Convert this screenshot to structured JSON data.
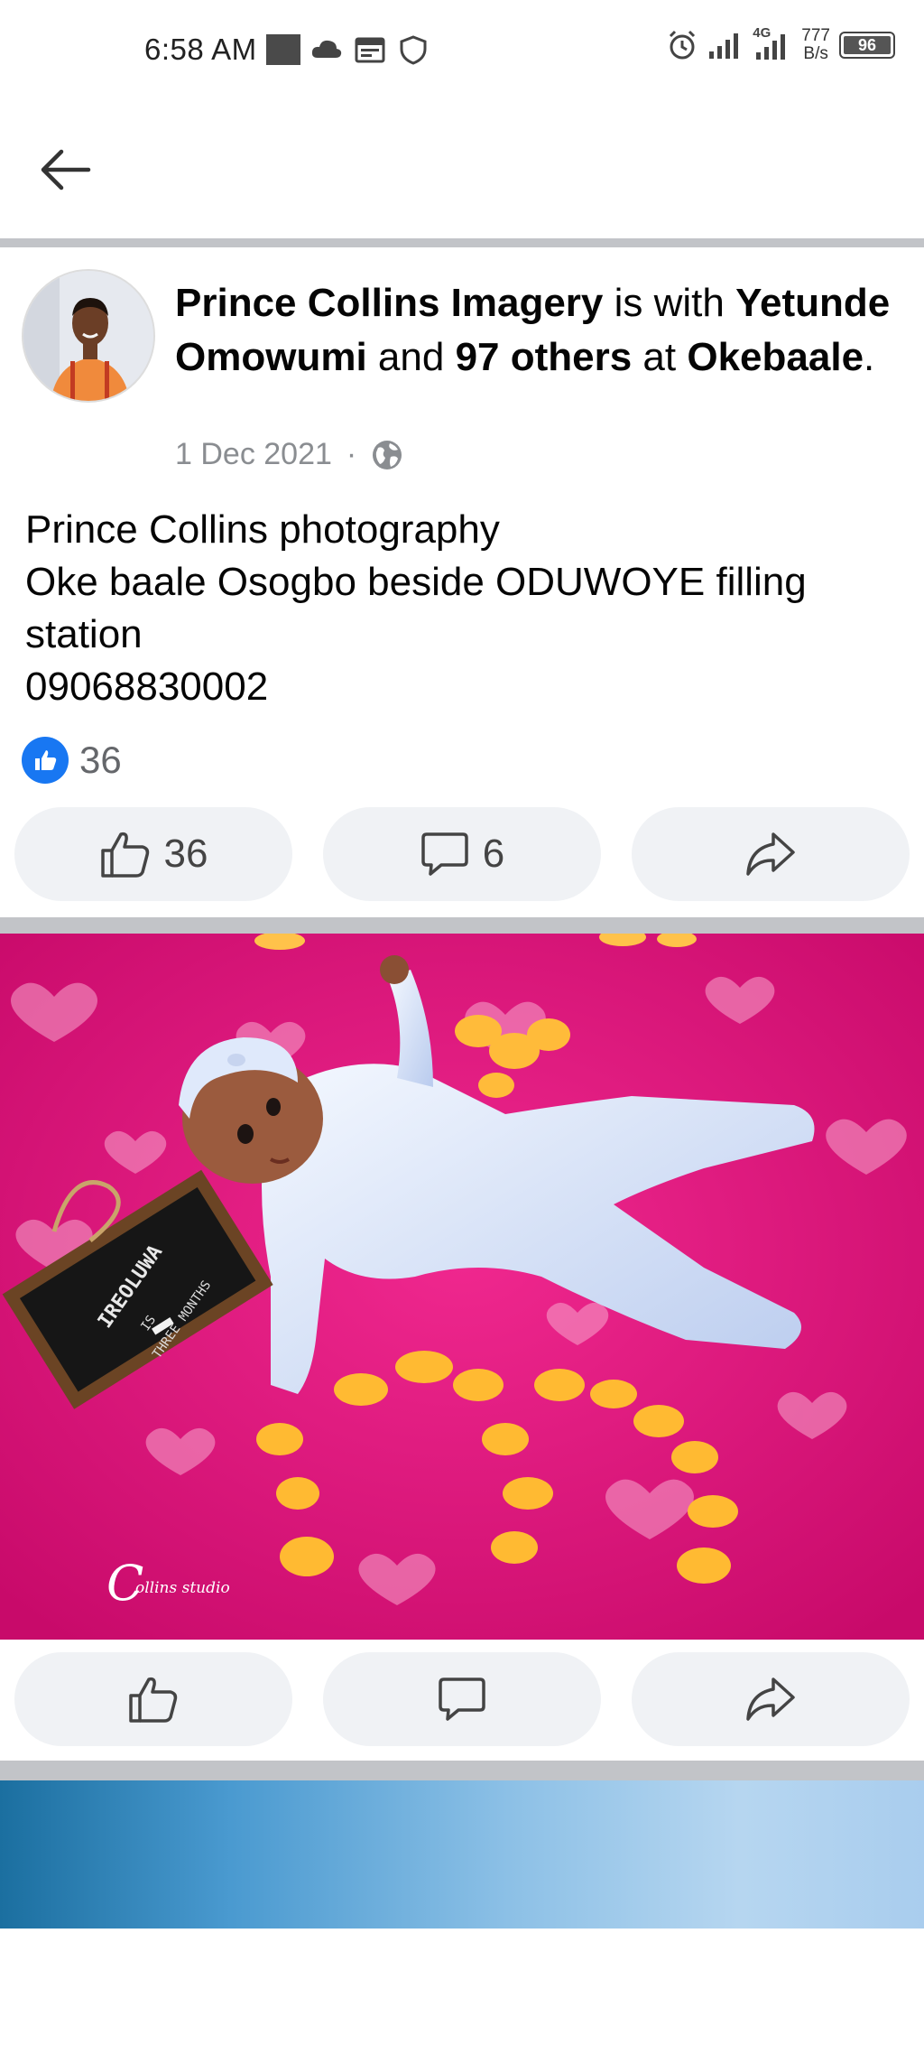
{
  "status_bar": {
    "time": "6:58 AM",
    "network": "4G",
    "speed_value": "777",
    "speed_unit": "B/s",
    "battery": "96"
  },
  "post": {
    "author": "Prince Collins Imagery",
    "is_with": " is with ",
    "tagged_person": "Yetunde Omowumi",
    "and": " and ",
    "others": "97 others",
    "at": " at ",
    "location": "Okebaale",
    "period": ".",
    "date": "1 Dec 2021",
    "separator": "·",
    "privacy_icon": "globe-icon",
    "text_lines": [
      "Prince Collins photography",
      "Oke baale Osogbo beside ODUWOYE filling",
      "station",
      "09068830002"
    ],
    "reaction_count": "36",
    "actions": {
      "like_count": "36",
      "comment_count": "6"
    }
  },
  "photo": {
    "slate_name": "IREOLUWA",
    "slate_is": "IS",
    "slate_age": "THREE MONTHS",
    "watermark": "ollins studio",
    "watermark_initial": "C"
  },
  "colors": {
    "facebook_blue": "#1877f2",
    "action_bg": "#f0f2f5",
    "divider": "#c2c4c8",
    "backdrop_pink": "#e0147a"
  }
}
